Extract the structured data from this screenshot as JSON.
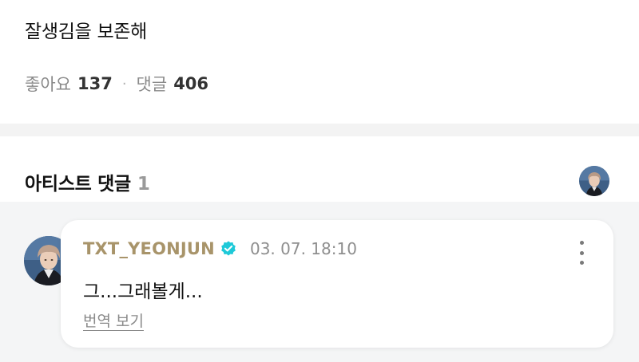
{
  "post": {
    "text": "잘생김을 보존해",
    "likes_label": "좋아요",
    "likes_count": "137",
    "separator": "·",
    "comments_label": "댓글",
    "comments_count": "406"
  },
  "artist_section": {
    "title": "아티스트 댓글",
    "count": "1",
    "avatar_icon": "artist-avatar"
  },
  "comment": {
    "author": "TXT_YEONJUN",
    "verified_icon": "verified-check-icon",
    "timestamp": "03. 07. 18:10",
    "text": "그...그래볼게...",
    "translate_label": "번역 보기",
    "more_icon": "more-vertical-icon"
  },
  "colors": {
    "author": "#a8946a",
    "verified": "#1ec9d8",
    "muted": "#8a8a8a",
    "comment_bg": "#f4f5f6"
  }
}
